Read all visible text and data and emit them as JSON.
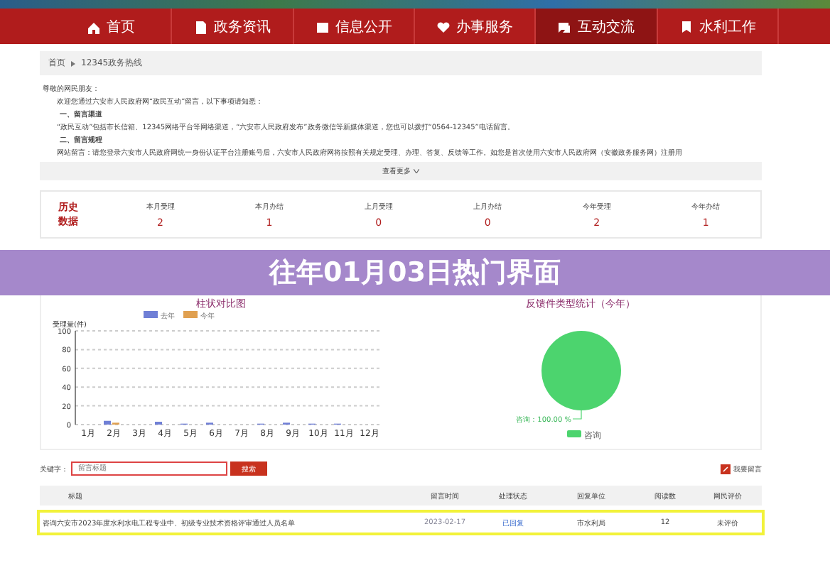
{
  "nav": [
    {
      "label": "首页",
      "selected": false
    },
    {
      "label": "政务资讯",
      "selected": false
    },
    {
      "label": "信息公开",
      "selected": false
    },
    {
      "label": "办事服务",
      "selected": false
    },
    {
      "label": "互动交流",
      "selected": true
    },
    {
      "label": "水利工作",
      "selected": false
    }
  ],
  "breadcrumb": [
    "首页",
    "12345政务热线"
  ],
  "notice": {
    "greeting": "尊敬的网民朋友：",
    "lines": [
      {
        "kind": "para",
        "text": "欢迎您通过六安市人民政府网“政民互动”留言，以下事项请知悉："
      },
      {
        "kind": "heading",
        "text": "一、留言渠道"
      },
      {
        "kind": "para",
        "text": "“政民互动”包括市长信箱、12345网络平台等网络渠道，“六安市人民政府发布”政务微信等新媒体渠道，您也可以拨打“0564-12345”电话留言。"
      },
      {
        "kind": "heading",
        "text": "二、留言规程"
      },
      {
        "kind": "para",
        "text": "网站留言：请您登录六安市人民政府网统一身份认证平台注册账号后，六安市人民政府网将按照有关规定受理、办理、答复、反馈等工作。如您是首次使用六安市人民政府网（安徽政务服务网）注册用"
      }
    ],
    "more": "查看更多"
  },
  "stats": {
    "title": "历史数据",
    "items": [
      {
        "label": "本月受理",
        "value": "2"
      },
      {
        "label": "本月办结",
        "value": "1"
      },
      {
        "label": "上月受理",
        "value": "0"
      },
      {
        "label": "上月办结",
        "value": "0"
      },
      {
        "label": "今年受理",
        "value": "2"
      },
      {
        "label": "今年办结",
        "value": "1"
      }
    ]
  },
  "banner": "往年01月03日热门界面",
  "bar_panel": {
    "title": "柱状对比图",
    "chart_data": {
      "type": "bar",
      "ylabel": "受理量(件)",
      "categories": [
        "1月",
        "2月",
        "3月",
        "4月",
        "5月",
        "6月",
        "7月",
        "8月",
        "9月",
        "10月",
        "11月",
        "12月"
      ],
      "series": [
        {
          "name": "去年",
          "color": "#6f7fd6",
          "values": [
            0,
            4,
            0,
            3,
            1,
            2,
            0,
            1,
            2,
            1,
            1,
            0
          ]
        },
        {
          "name": "今年",
          "color": "#e0a050",
          "values": [
            0,
            2,
            0,
            0,
            0,
            0,
            0,
            0,
            0,
            0,
            0,
            0
          ]
        }
      ],
      "ylim": [
        0,
        100
      ],
      "yticks": [
        0,
        20,
        40,
        60,
        80,
        100
      ],
      "grid": true,
      "legend": "top"
    }
  },
  "pie_panel": {
    "title": "反馈件类型统计（今年）",
    "chart_data": {
      "type": "pie",
      "series": [
        {
          "name": "咨询",
          "color": "#4cd46e",
          "values": [
            100
          ]
        }
      ],
      "value_labels": [
        "咨询：100.00 %"
      ]
    }
  },
  "search": {
    "label": "关键字：",
    "placeholder": "留言标题",
    "button": "搜索",
    "write": "我要留言"
  },
  "table": {
    "columns": [
      "标题",
      "留言时间",
      "处理状态",
      "回复单位",
      "阅读数",
      "网民评价"
    ],
    "rows": [
      {
        "cells": [
          "咨询六安市2023年度水利水电工程专业中、初级专业技术资格评审通过人员名单",
          "2023-02-17",
          "已回复",
          "市水利局",
          "12",
          "未评价"
        ],
        "selected": true
      }
    ]
  }
}
